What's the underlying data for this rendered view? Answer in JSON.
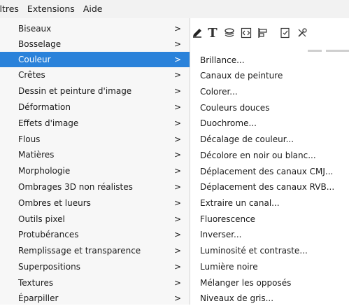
{
  "menubar": {
    "items": [
      "iltres",
      "Extensions",
      "Aide"
    ]
  },
  "menu": {
    "items": [
      {
        "label": "Biseaux",
        "arrow": ">"
      },
      {
        "label": "Bosselage",
        "arrow": ">"
      },
      {
        "label": "Couleur",
        "arrow": ">",
        "active": true
      },
      {
        "label": "Crêtes",
        "arrow": ">"
      },
      {
        "label": "Dessin et peinture d'image",
        "arrow": ">"
      },
      {
        "label": "Déformation",
        "arrow": ">"
      },
      {
        "label": "Effets d'image",
        "arrow": ">"
      },
      {
        "label": "Flous",
        "arrow": ">"
      },
      {
        "label": "Matières",
        "arrow": ">"
      },
      {
        "label": "Morphologie",
        "arrow": ">"
      },
      {
        "label": "Ombrages 3D non réalistes",
        "arrow": ">"
      },
      {
        "label": "Ombres et lueurs",
        "arrow": ">"
      },
      {
        "label": "Outils pixel",
        "arrow": ">"
      },
      {
        "label": "Protubérances",
        "arrow": ">"
      },
      {
        "label": "Remplissage et transparence",
        "arrow": ">"
      },
      {
        "label": "Superpositions",
        "arrow": ">"
      },
      {
        "label": "Textures",
        "arrow": ">"
      },
      {
        "label": "Éparpiller",
        "arrow": ">"
      }
    ]
  },
  "submenu": {
    "items": [
      "Brillance...",
      "Canaux de peinture",
      "Colorer...",
      "Couleurs douces",
      "Duochrome...",
      "Décalage de couleur...",
      "Décolore en noir ou blanc...",
      "Déplacement des canaux CMJ...",
      "Déplacement des canaux RVB...",
      "Extraire un canal...",
      "Fluorescence",
      "Inverser...",
      "Luminosité et contraste...",
      "Lumière noire",
      "Mélanger les opposés",
      "Niveaux de gris..."
    ]
  },
  "toolbar": {
    "text_glyph": "T"
  },
  "colors": {
    "accent": "#2a82da",
    "menu_bg": "#f7f7f7",
    "menubar_bg": "#f2f2f2"
  }
}
